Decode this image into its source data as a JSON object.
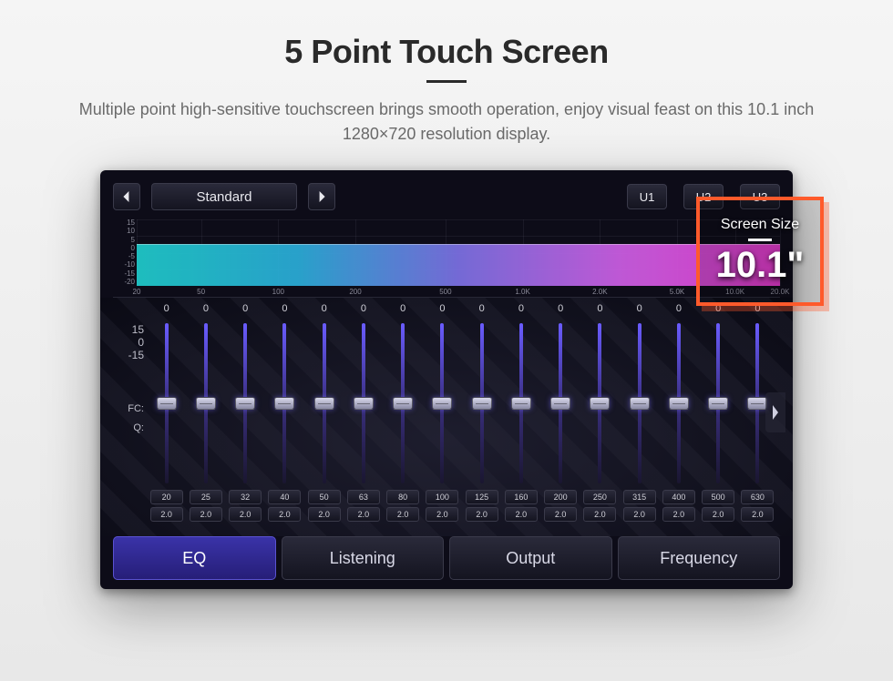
{
  "page": {
    "title": "5 Point Touch Screen",
    "subtitle": "Multiple point high-sensitive touchscreen brings smooth operation, enjoy visual feast on this 10.1 inch 1280×720 resolution display."
  },
  "badge": {
    "label": "Screen Size",
    "value": "10.1\""
  },
  "eq": {
    "preset": "Standard",
    "user_presets": [
      "U1",
      "U2",
      "U3"
    ],
    "spectrum": {
      "y_ticks": [
        "15",
        "10",
        "5",
        "0",
        "-5",
        "-10",
        "-15",
        "-20"
      ],
      "x_ticks": [
        {
          "label": "20",
          "pos": 0
        },
        {
          "label": "50",
          "pos": 10
        },
        {
          "label": "100",
          "pos": 22
        },
        {
          "label": "200",
          "pos": 34
        },
        {
          "label": "500",
          "pos": 48
        },
        {
          "label": "1.0K",
          "pos": 60
        },
        {
          "label": "2.0K",
          "pos": 72
        },
        {
          "label": "5.0K",
          "pos": 84
        },
        {
          "label": "10.0K",
          "pos": 93
        },
        {
          "label": "20.0K",
          "pos": 100
        }
      ]
    },
    "scale": {
      "top": "15",
      "mid": "0",
      "bottom": "-15"
    },
    "row_labels": {
      "fc": "FC:",
      "q": "Q:"
    },
    "bands": [
      {
        "gain": "0",
        "fc": "20",
        "q": "2.0"
      },
      {
        "gain": "0",
        "fc": "25",
        "q": "2.0"
      },
      {
        "gain": "0",
        "fc": "32",
        "q": "2.0"
      },
      {
        "gain": "0",
        "fc": "40",
        "q": "2.0"
      },
      {
        "gain": "0",
        "fc": "50",
        "q": "2.0"
      },
      {
        "gain": "0",
        "fc": "63",
        "q": "2.0"
      },
      {
        "gain": "0",
        "fc": "80",
        "q": "2.0"
      },
      {
        "gain": "0",
        "fc": "100",
        "q": "2.0"
      },
      {
        "gain": "0",
        "fc": "125",
        "q": "2.0"
      },
      {
        "gain": "0",
        "fc": "160",
        "q": "2.0"
      },
      {
        "gain": "0",
        "fc": "200",
        "q": "2.0"
      },
      {
        "gain": "0",
        "fc": "250",
        "q": "2.0"
      },
      {
        "gain": "0",
        "fc": "315",
        "q": "2.0"
      },
      {
        "gain": "0",
        "fc": "400",
        "q": "2.0"
      },
      {
        "gain": "0",
        "fc": "500",
        "q": "2.0"
      },
      {
        "gain": "0",
        "fc": "630",
        "q": "2.0"
      }
    ],
    "tabs": [
      {
        "label": "EQ",
        "active": true
      },
      {
        "label": "Listening",
        "active": false
      },
      {
        "label": "Output",
        "active": false
      },
      {
        "label": "Frequency",
        "active": false
      }
    ]
  }
}
